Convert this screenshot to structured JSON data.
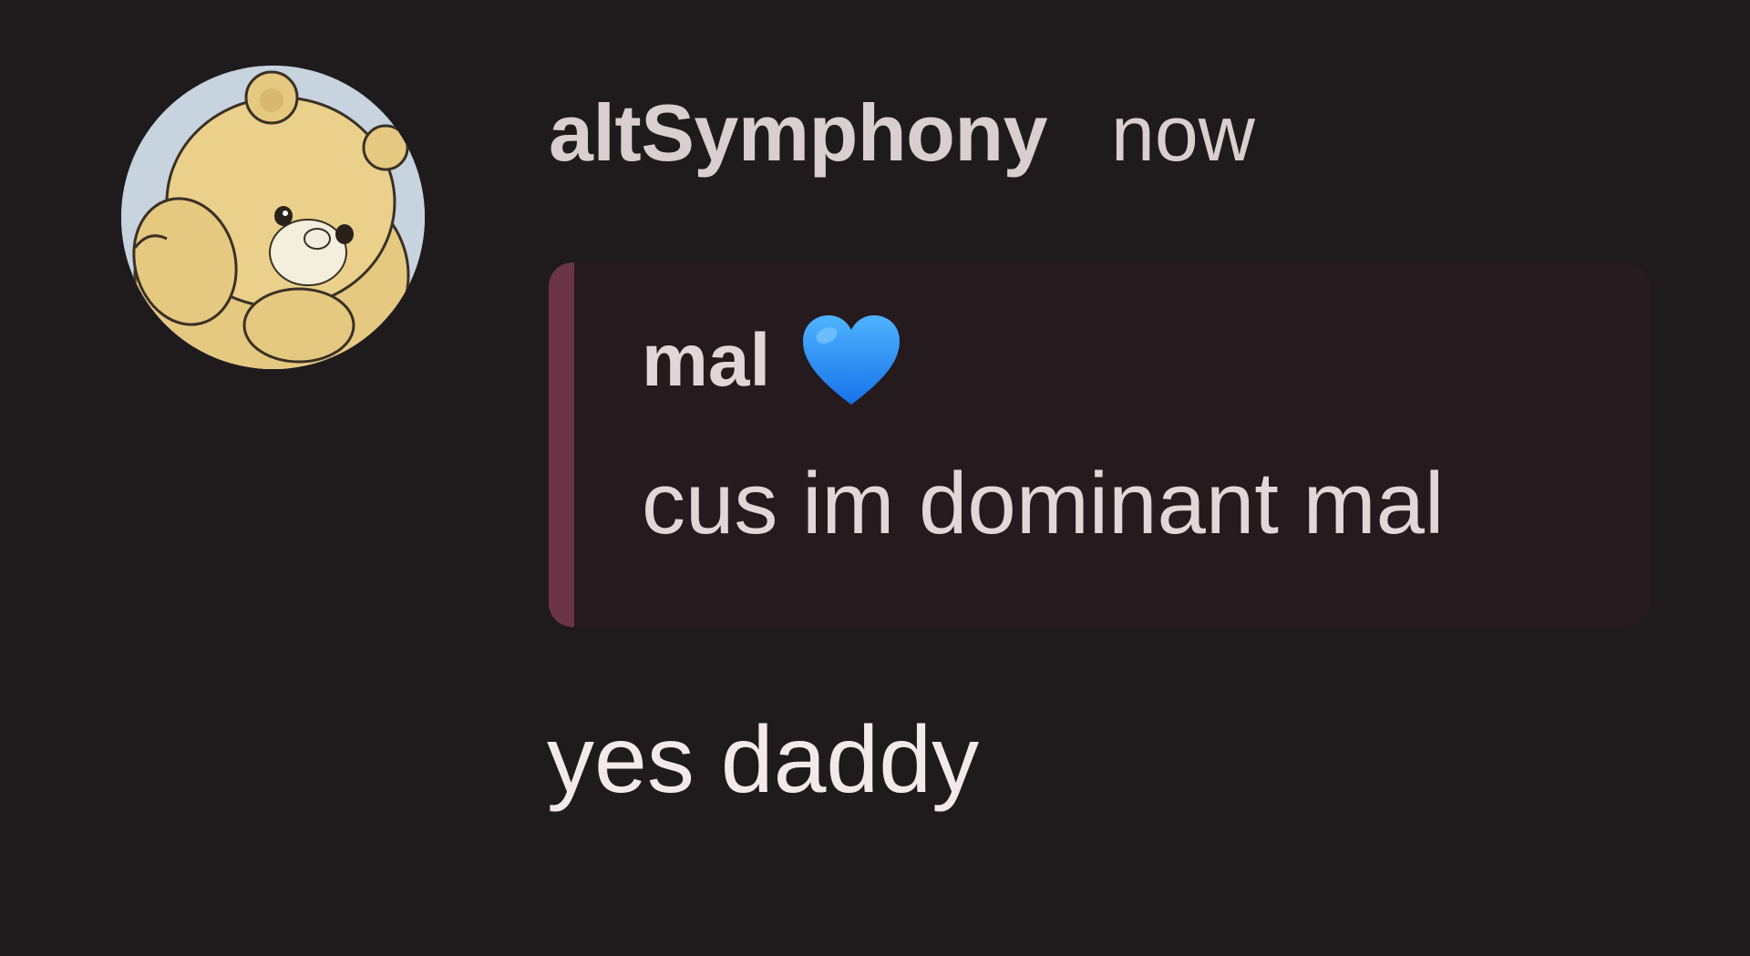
{
  "comment": {
    "avatar_icon": "teddy-bear-avatar-icon",
    "username": "altSymphony",
    "timestamp": "now",
    "reply_preview": {
      "author": "mal",
      "author_emoji_icon": "blue-heart-icon",
      "text": "cus im dominant mal"
    },
    "message": "yes daddy"
  },
  "colors": {
    "background": "#1f1b1c",
    "reply_background": "#251a1d",
    "reply_accent": "#6b3446",
    "heart": "#1e90ff",
    "text": "#e2d6d6"
  }
}
